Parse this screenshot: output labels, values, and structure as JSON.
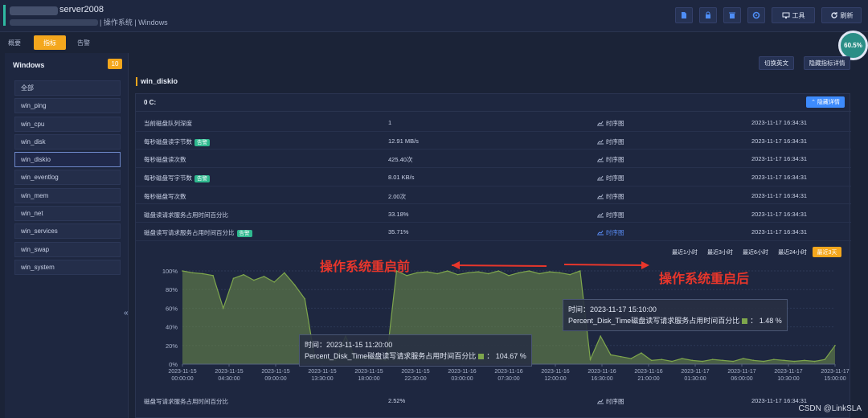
{
  "topbar": {
    "host_name": "server2008",
    "host_sub": "| 操作系统 | Windows",
    "icons": [
      "file-icon",
      "lock-icon",
      "trash-icon",
      "gear-icon"
    ],
    "tools_label": "工具",
    "refresh_label": "刷新"
  },
  "tabs": [
    "概要",
    "指标",
    "告警"
  ],
  "gauge": "60.5%",
  "sidebar": {
    "title": "Windows",
    "count": "10",
    "items": [
      "全部",
      "win_ping",
      "win_cpu",
      "win_disk",
      "win_diskio",
      "win_eventlog",
      "win_mem",
      "win_net",
      "win_services",
      "win_swap",
      "win_system"
    ],
    "collapse": "«"
  },
  "main": {
    "actions": [
      "切换英文",
      "隐藏指标详情"
    ],
    "section_title": "win_diskio",
    "panel_title": "0 C:",
    "hide_button": "⌃ 隐藏详情",
    "trend_label": "时序图",
    "rows": [
      {
        "name": "当前磁盘队列深度",
        "badge": "",
        "value": "1",
        "time": "2023-11-17 16:34:31"
      },
      {
        "name": "每秒磁盘读字节数",
        "badge": "告警",
        "value": "12.91 MB/s",
        "time": "2023-11-17 16:34:31"
      },
      {
        "name": "每秒磁盘读次数",
        "badge": "",
        "value": "425.40次",
        "time": "2023-11-17 16:34:31"
      },
      {
        "name": "每秒磁盘写字节数",
        "badge": "告警",
        "value": "8.01 KB/s",
        "time": "2023-11-17 16:34:31"
      },
      {
        "name": "每秒磁盘写次数",
        "badge": "",
        "value": "2.00次",
        "time": "2023-11-17 16:34:31"
      },
      {
        "name": "磁盘读请求服务占用时间百分比",
        "badge": "",
        "value": "33.18%",
        "time": "2023-11-17 16:34:31"
      },
      {
        "name": "磁盘读写请求服务占用时间百分比",
        "badge": "告警",
        "value": "35.71%",
        "time": "2023-11-17 16:34:31"
      }
    ],
    "ranges": [
      "最近1小时",
      "最近3小时",
      "最近6小时",
      "最近24小时",
      "最近3天"
    ],
    "last_row": {
      "name": "磁盘写请求服务占用时间百分比",
      "value": "2.52%",
      "time": "2023-11-17 16:34:31"
    }
  },
  "annotations": {
    "before": "操作系统重启前",
    "after": "操作系统重启后"
  },
  "tooltip1": {
    "time": "时间：2023-11-15 11:20:00",
    "text": "Percent_Disk_Time磁盘读写请求服务占用时间百分比",
    "value": "： 104.67 %"
  },
  "tooltip2": {
    "time": "时间：2023-11-17 15:10:00",
    "text": "Percent_Disk_Time磁盘读写请求服务占用时间百分比",
    "value": "： 1.48 %"
  },
  "watermark": "CSDN @LinkSLA",
  "chart_data": {
    "type": "area",
    "ylim": [
      0,
      100
    ],
    "ytick_labels": [
      "0%",
      "20%",
      "40%",
      "60%",
      "80%",
      "100%"
    ],
    "xtick_labels": [
      [
        "2023-11-15",
        "00:00:00"
      ],
      [
        "2023-11-15",
        "04:30:00"
      ],
      [
        "2023-11-15",
        "09:00:00"
      ],
      [
        "2023-11-15",
        "13:30:00"
      ],
      [
        "2023-11-15",
        "18:00:00"
      ],
      [
        "2023-11-15",
        "22:30:00"
      ],
      [
        "2023-11-16",
        "03:00:00"
      ],
      [
        "2023-11-16",
        "07:30:00"
      ],
      [
        "2023-11-16",
        "12:00:00"
      ],
      [
        "2023-11-16",
        "16:30:00"
      ],
      [
        "2023-11-16",
        "21:00:00"
      ],
      [
        "2023-11-17",
        "01:30:00"
      ],
      [
        "2023-11-17",
        "06:00:00"
      ],
      [
        "2023-11-17",
        "10:30:00"
      ],
      [
        "2023-11-17",
        "15:00:00"
      ]
    ],
    "x_hours": [
      0,
      1,
      2,
      3,
      4,
      5,
      6,
      7,
      8,
      9,
      10,
      11,
      12,
      13,
      14,
      15,
      16,
      17,
      18,
      19,
      20,
      21,
      22,
      23,
      24,
      25,
      26,
      27,
      28,
      29,
      30,
      31,
      32,
      33,
      34,
      35,
      36,
      37,
      38,
      39,
      40,
      41,
      42,
      43,
      44,
      45,
      46,
      47,
      48,
      49,
      50,
      51,
      52,
      53,
      54,
      55,
      56,
      57,
      58,
      59,
      60,
      61,
      62,
      63,
      64
    ],
    "values": [
      100,
      98,
      97,
      95,
      60,
      92,
      96,
      90,
      94,
      88,
      98,
      85,
      70,
      5,
      6,
      4,
      30,
      5,
      8,
      6,
      4,
      100,
      95,
      98,
      99,
      97,
      100,
      96,
      98,
      99,
      97,
      100,
      95,
      98,
      100,
      97,
      99,
      98,
      96,
      100,
      5,
      30,
      10,
      8,
      6,
      12,
      4,
      5,
      3,
      6,
      4,
      3,
      5,
      4,
      3,
      6,
      4,
      3,
      5,
      4,
      3,
      4,
      3,
      5,
      20
    ],
    "series_color": "#7ea64c"
  }
}
